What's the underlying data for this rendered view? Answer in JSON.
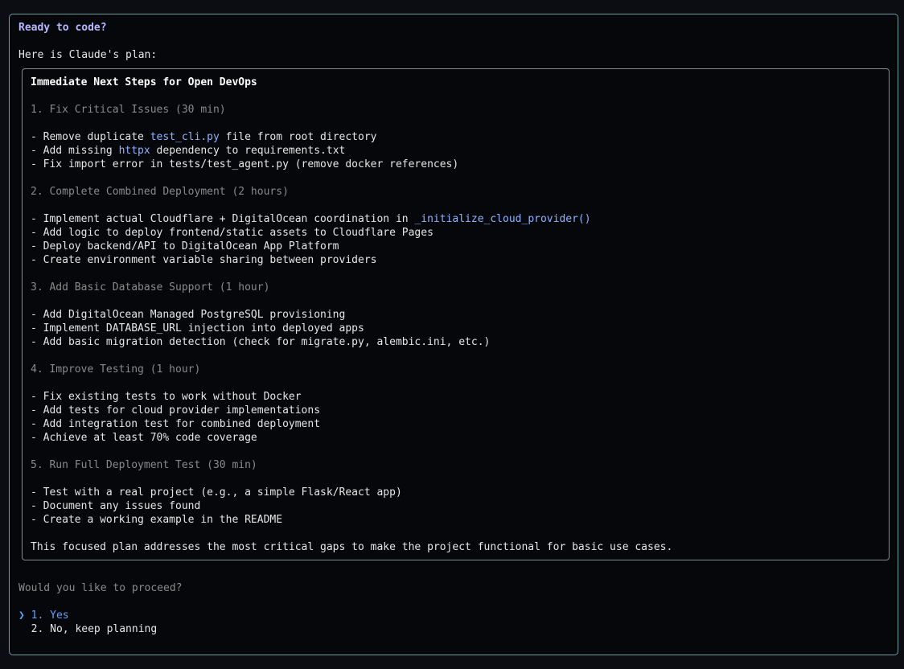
{
  "prompt_title": "Ready to code?",
  "intro": "Here is Claude's plan:",
  "plan": {
    "heading": "Immediate Next Steps for Open DevOps",
    "sections": [
      {
        "title": "1. Fix Critical Issues (30 min)",
        "items": [
          [
            "- Remove duplicate ",
            "test_cli.py",
            " file from root directory"
          ],
          [
            "- Add missing ",
            "httpx",
            " dependency to requirements.txt"
          ],
          [
            "- Fix import error in tests/test_agent.py (remove docker references)",
            "",
            ""
          ]
        ]
      },
      {
        "title": "2. Complete Combined Deployment (2 hours)",
        "items": [
          [
            "- Implement actual Cloudflare + DigitalOcean coordination in ",
            "_initialize_cloud_provider()",
            ""
          ],
          [
            "- Add logic to deploy frontend/static assets to Cloudflare Pages",
            "",
            ""
          ],
          [
            "- Deploy backend/API to DigitalOcean App Platform",
            "",
            ""
          ],
          [
            "- Create environment variable sharing between providers",
            "",
            ""
          ]
        ]
      },
      {
        "title": "3. Add Basic Database Support (1 hour)",
        "items": [
          [
            "- Add DigitalOcean Managed PostgreSQL provisioning",
            "",
            ""
          ],
          [
            "- Implement DATABASE_URL injection into deployed apps",
            "",
            ""
          ],
          [
            "- Add basic migration detection (check for migrate.py, alembic.ini, etc.)",
            "",
            ""
          ]
        ]
      },
      {
        "title": "4. Improve Testing (1 hour)",
        "items": [
          [
            "- Fix existing tests to work without Docker",
            "",
            ""
          ],
          [
            "- Add tests for cloud provider implementations",
            "",
            ""
          ],
          [
            "- Add integration test for combined deployment",
            "",
            ""
          ],
          [
            "- Achieve at least 70% code coverage",
            "",
            ""
          ]
        ]
      },
      {
        "title": "5. Run Full Deployment Test (30 min)",
        "items": [
          [
            "- Test with a real project (e.g., a simple Flask/React app)",
            "",
            ""
          ],
          [
            "- Document any issues found",
            "",
            ""
          ],
          [
            "- Create a working example in the README",
            "",
            ""
          ]
        ]
      }
    ],
    "conclusion": "This focused plan addresses the most critical gaps to make the project functional for basic use cases."
  },
  "question": "Would you like to proceed?",
  "options": {
    "cursor": "❯",
    "selected": "1. Yes",
    "other": "2. No, keep planning"
  },
  "colors": {
    "title": "#b8b7ff",
    "code": "#8db4ff",
    "selected": "#5ea2ff",
    "muted": "#8a8a8a",
    "frame_border": "#6f9c9e"
  }
}
